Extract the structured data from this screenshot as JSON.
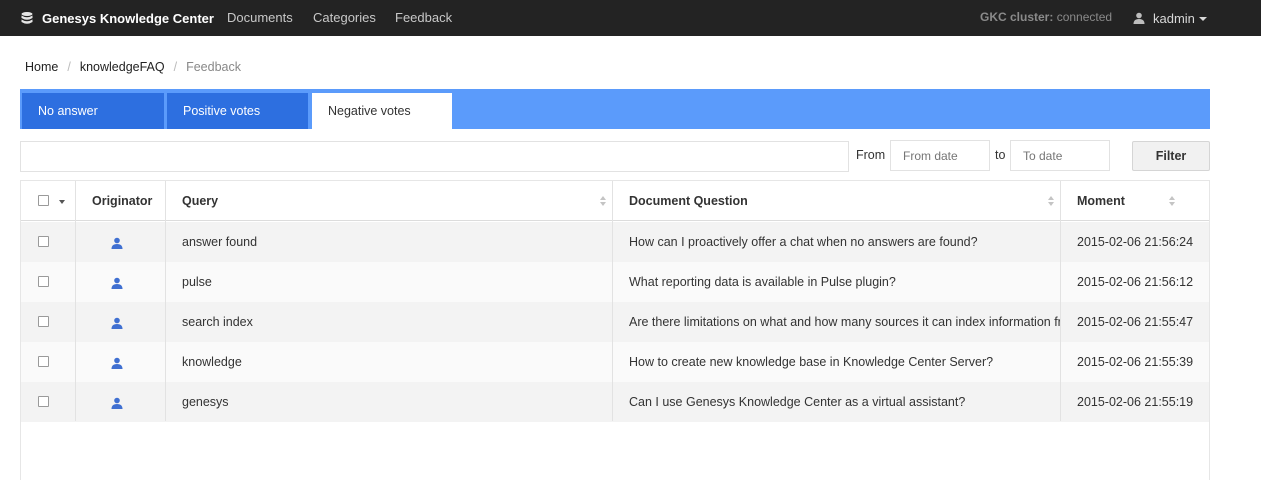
{
  "navbar": {
    "brand": "Genesys Knowledge Center",
    "links": [
      "Documents",
      "Categories",
      "Feedback"
    ],
    "cluster_label": "GKC cluster:",
    "cluster_status": "connected",
    "user": "kadmin"
  },
  "breadcrumb": {
    "items": [
      "Home",
      "knowledgeFAQ",
      "Feedback"
    ]
  },
  "tabs": [
    {
      "label": "No answer"
    },
    {
      "label": "Positive votes"
    },
    {
      "label": "Negative votes"
    }
  ],
  "filter": {
    "search_value": "",
    "from_label": "From",
    "from_placeholder": "From date",
    "to_label": "to",
    "to_placeholder": "To date",
    "button_label": "Filter"
  },
  "table": {
    "headers": {
      "originator": "Originator",
      "query": "Query",
      "question": "Document Question",
      "moment": "Moment"
    },
    "rows": [
      {
        "query": "answer found",
        "question": "How can I proactively offer a chat when no answers are found?",
        "moment": "2015-02-06 21:56:24"
      },
      {
        "query": "pulse",
        "question": "What reporting data is available in Pulse plugin?",
        "moment": "2015-02-06 21:56:12"
      },
      {
        "query": "search index",
        "question": "Are there limitations on what and how many sources it can index information fro",
        "moment": "2015-02-06 21:55:47"
      },
      {
        "query": "knowledge",
        "question": "How to create new knowledge base in Knowledge Center Server?",
        "moment": "2015-02-06 21:55:39"
      },
      {
        "query": "genesys",
        "question": "Can I use Genesys Knowledge Center as a virtual assistant?",
        "moment": "2015-02-06 21:55:19"
      }
    ]
  }
}
